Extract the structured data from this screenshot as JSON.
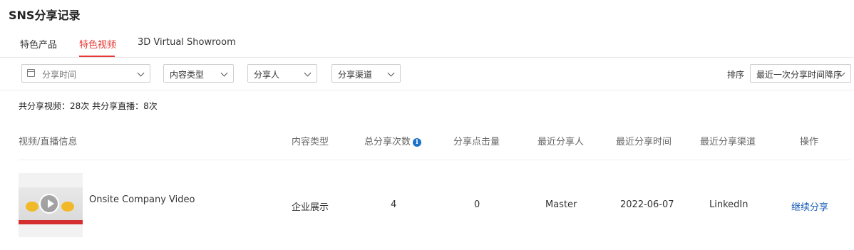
{
  "page_title": "SNS分享记录",
  "tabs": [
    {
      "label": "特色产品",
      "active": false
    },
    {
      "label": "特色视频",
      "active": true
    },
    {
      "label": "3D Virtual Showroom",
      "active": false
    }
  ],
  "filters": {
    "share_time": "分享时间",
    "content_type": "内容类型",
    "sharer": "分享人",
    "channel": "分享渠道",
    "sort_label": "排序",
    "sort_value": "最近一次分享时间降序"
  },
  "summary": "共分享视频：28次 共分享直播：8次",
  "table": {
    "headers": {
      "info": "视频/直播信息",
      "content_type": "内容类型",
      "total_shares": "总分享次数",
      "clicks": "分享点击量",
      "last_sharer": "最近分享人",
      "last_time": "最近分享时间",
      "last_channel": "最近分享渠道",
      "action": "操作"
    },
    "rows": [
      {
        "title": "Onsite Company Video",
        "content_type": "企业展示",
        "total_shares": "4",
        "clicks": "0",
        "last_sharer": "Master",
        "last_time": "2022-06-07",
        "last_channel": "LinkedIn",
        "action": "继续分享"
      }
    ]
  },
  "colors": {
    "accent": "#e53935",
    "link": "#1a5fb4",
    "info_icon": "#1a73c8"
  },
  "icons": [
    "calendar-icon",
    "chevron-down-icon",
    "info-icon",
    "play-icon"
  ]
}
